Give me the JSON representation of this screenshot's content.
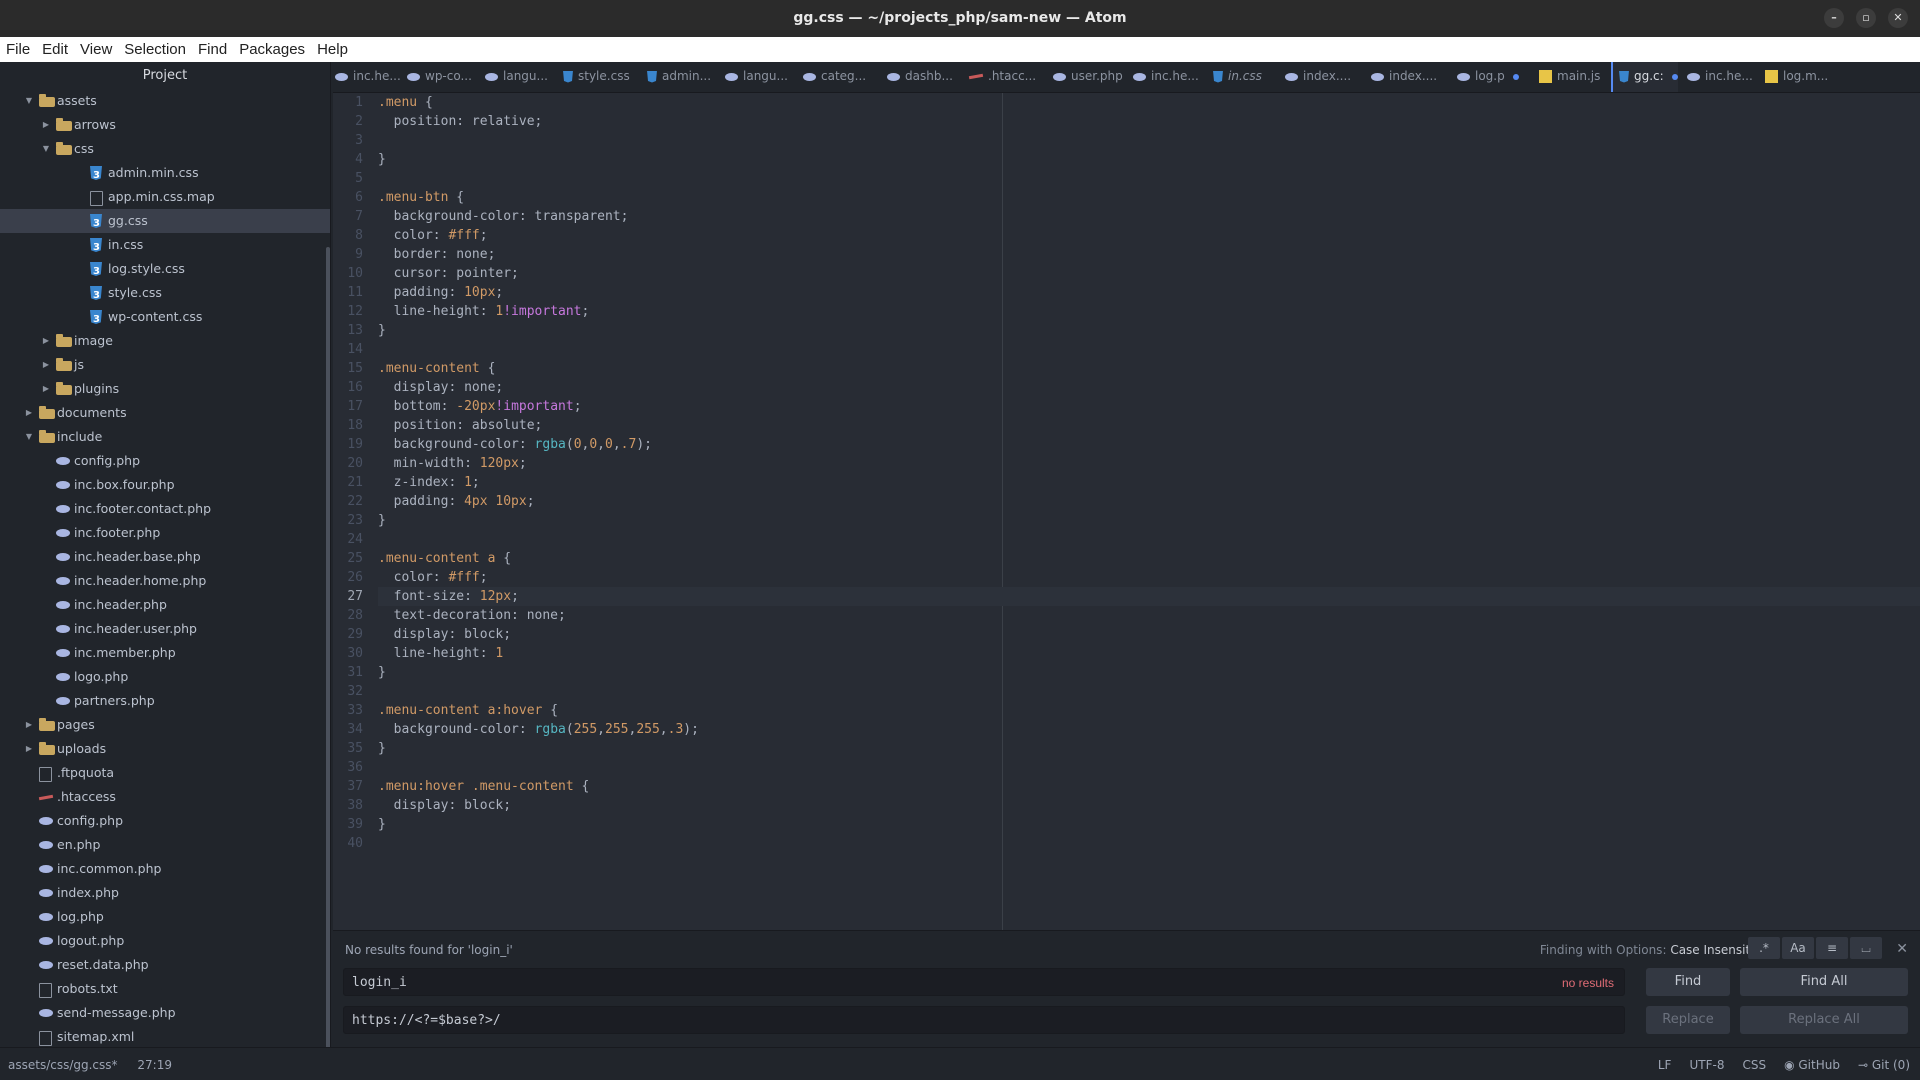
{
  "window": {
    "title": "gg.css — ~/projects_php/sam-new — Atom"
  },
  "menu": [
    "File",
    "Edit",
    "View",
    "Selection",
    "Find",
    "Packages",
    "Help"
  ],
  "sidebar": {
    "title": "Project",
    "tree": [
      {
        "label": "assets",
        "type": "folder",
        "depth": 0,
        "expanded": true
      },
      {
        "label": "arrows",
        "type": "folder",
        "depth": 1,
        "expanded": false
      },
      {
        "label": "css",
        "type": "folder",
        "depth": 1,
        "expanded": true
      },
      {
        "label": "admin.min.css",
        "type": "css3",
        "depth": 2
      },
      {
        "label": "app.min.css.map",
        "type": "file",
        "depth": 2
      },
      {
        "label": "gg.css",
        "type": "css3",
        "depth": 2,
        "selected": true
      },
      {
        "label": "in.css",
        "type": "css3",
        "depth": 2
      },
      {
        "label": "log.style.css",
        "type": "css3",
        "depth": 2
      },
      {
        "label": "style.css",
        "type": "css3",
        "depth": 2
      },
      {
        "label": "wp-content.css",
        "type": "css3",
        "depth": 2
      },
      {
        "label": "image",
        "type": "folder",
        "depth": 1,
        "expanded": false
      },
      {
        "label": "js",
        "type": "folder",
        "depth": 1,
        "expanded": false
      },
      {
        "label": "plugins",
        "type": "folder",
        "depth": 1,
        "expanded": false
      },
      {
        "label": "documents",
        "type": "folder",
        "depth": 0,
        "expanded": false
      },
      {
        "label": "include",
        "type": "folder",
        "depth": 0,
        "expanded": true
      },
      {
        "label": "config.php",
        "type": "php",
        "depth": 1
      },
      {
        "label": "inc.box.four.php",
        "type": "php",
        "depth": 1
      },
      {
        "label": "inc.footer.contact.php",
        "type": "php",
        "depth": 1
      },
      {
        "label": "inc.footer.php",
        "type": "php",
        "depth": 1
      },
      {
        "label": "inc.header.base.php",
        "type": "php",
        "depth": 1
      },
      {
        "label": "inc.header.home.php",
        "type": "php",
        "depth": 1
      },
      {
        "label": "inc.header.php",
        "type": "php",
        "depth": 1
      },
      {
        "label": "inc.header.user.php",
        "type": "php",
        "depth": 1
      },
      {
        "label": "inc.member.php",
        "type": "php",
        "depth": 1
      },
      {
        "label": "logo.php",
        "type": "php",
        "depth": 1
      },
      {
        "label": "partners.php",
        "type": "php",
        "depth": 1
      },
      {
        "label": "pages",
        "type": "folder",
        "depth": 0,
        "expanded": false
      },
      {
        "label": "uploads",
        "type": "folder",
        "depth": 0,
        "expanded": false
      },
      {
        "label": ".ftpquota",
        "type": "file",
        "depth": 0
      },
      {
        "label": ".htaccess",
        "type": "htaccess",
        "depth": 0
      },
      {
        "label": "config.php",
        "type": "php",
        "depth": 0
      },
      {
        "label": "en.php",
        "type": "php",
        "depth": 0
      },
      {
        "label": "inc.common.php",
        "type": "php",
        "depth": 0
      },
      {
        "label": "index.php",
        "type": "php",
        "depth": 0
      },
      {
        "label": "log.php",
        "type": "php",
        "depth": 0
      },
      {
        "label": "logout.php",
        "type": "php",
        "depth": 0
      },
      {
        "label": "reset.data.php",
        "type": "php",
        "depth": 0
      },
      {
        "label": "robots.txt",
        "type": "file",
        "depth": 0
      },
      {
        "label": "send-message.php",
        "type": "php",
        "depth": 0
      },
      {
        "label": "sitemap.xml",
        "type": "file",
        "depth": 0
      }
    ]
  },
  "tabs": [
    {
      "label": "inc.he...",
      "icon": "php"
    },
    {
      "label": "wp-co...",
      "icon": "php"
    },
    {
      "label": "langu...",
      "icon": "php"
    },
    {
      "label": "style.css",
      "icon": "css"
    },
    {
      "label": "admin...",
      "icon": "css"
    },
    {
      "label": "langu...",
      "icon": "php"
    },
    {
      "label": "categ...",
      "icon": "php"
    },
    {
      "label": "dashb...",
      "icon": "php"
    },
    {
      "label": ".htacc...",
      "icon": "ht"
    },
    {
      "label": "user.php",
      "icon": "php"
    },
    {
      "label": "inc.he...",
      "icon": "php"
    },
    {
      "label": "in.css",
      "icon": "css",
      "italic": true
    },
    {
      "label": "index....",
      "icon": "php"
    },
    {
      "label": "index....",
      "icon": "php"
    },
    {
      "label": "log.p",
      "icon": "php",
      "modified": true
    },
    {
      "label": "main.js",
      "icon": "js"
    },
    {
      "label": "gg.c:",
      "icon": "css",
      "modified": true,
      "active": true
    },
    {
      "label": "inc.he...",
      "icon": "php"
    },
    {
      "label": "log.m...",
      "icon": "js"
    }
  ],
  "editor": {
    "cursor_line": 27,
    "lines": [
      [
        [
          "sel-c",
          ".menu"
        ],
        [
          "pl",
          " {"
        ]
      ],
      [
        [
          "prop",
          "  position: relative;"
        ]
      ],
      [],
      [
        [
          "pl",
          "}"
        ]
      ],
      [],
      [
        [
          "sel-c",
          ".menu-btn"
        ],
        [
          "pl",
          " {"
        ]
      ],
      [
        [
          "prop",
          "  background-color: transparent;"
        ]
      ],
      [
        [
          "prop",
          "  color: "
        ],
        [
          "num",
          "#fff"
        ],
        [
          "pl",
          ";"
        ]
      ],
      [
        [
          "prop",
          "  border: none;"
        ]
      ],
      [
        [
          "prop",
          "  cursor: pointer;"
        ]
      ],
      [
        [
          "prop",
          "  padding: "
        ],
        [
          "num",
          "10px"
        ],
        [
          "pl",
          ";"
        ]
      ],
      [
        [
          "prop",
          "  line-height: "
        ],
        [
          "num",
          "1"
        ],
        [
          "kw",
          "!important"
        ],
        [
          "pl",
          ";"
        ]
      ],
      [
        [
          "pl",
          "}"
        ]
      ],
      [],
      [
        [
          "sel-c",
          ".menu-content"
        ],
        [
          "pl",
          " {"
        ]
      ],
      [
        [
          "prop",
          "  display: none;"
        ]
      ],
      [
        [
          "prop",
          "  bottom: "
        ],
        [
          "num",
          "-20px"
        ],
        [
          "kw",
          "!important"
        ],
        [
          "pl",
          ";"
        ]
      ],
      [
        [
          "prop",
          "  position: absolute;"
        ]
      ],
      [
        [
          "prop",
          "  background-color: "
        ],
        [
          "fn",
          "rgba"
        ],
        [
          "pl",
          "("
        ],
        [
          "num",
          "0"
        ],
        [
          "pl",
          ","
        ],
        [
          "num",
          "0"
        ],
        [
          "pl",
          ","
        ],
        [
          "num",
          "0"
        ],
        [
          "pl",
          ","
        ],
        [
          "num",
          ".7"
        ],
        [
          "pl",
          ");"
        ]
      ],
      [
        [
          "prop",
          "  min-width: "
        ],
        [
          "num",
          "120px"
        ],
        [
          "pl",
          ";"
        ]
      ],
      [
        [
          "prop",
          "  z-index: "
        ],
        [
          "num",
          "1"
        ],
        [
          "pl",
          ";"
        ]
      ],
      [
        [
          "prop",
          "  padding: "
        ],
        [
          "num",
          "4px 10px"
        ],
        [
          "pl",
          ";"
        ]
      ],
      [
        [
          "pl",
          "}"
        ]
      ],
      [],
      [
        [
          "sel-c",
          ".menu-content a"
        ],
        [
          "pl",
          " {"
        ]
      ],
      [
        [
          "prop",
          "  color: "
        ],
        [
          "num",
          "#fff"
        ],
        [
          "pl",
          ";"
        ]
      ],
      [
        [
          "prop",
          "  font-size: "
        ],
        [
          "num",
          "12px"
        ],
        [
          "pl",
          ";"
        ]
      ],
      [
        [
          "prop",
          "  text-decoration: none;"
        ]
      ],
      [
        [
          "prop",
          "  display: block;"
        ]
      ],
      [
        [
          "prop",
          "  line-height: "
        ],
        [
          "num",
          "1"
        ]
      ],
      [
        [
          "pl",
          "}"
        ]
      ],
      [],
      [
        [
          "sel-c",
          ".menu-content a:hover"
        ],
        [
          "pl",
          " {"
        ]
      ],
      [
        [
          "prop",
          "  background-color: "
        ],
        [
          "fn",
          "rgba"
        ],
        [
          "pl",
          "("
        ],
        [
          "num",
          "255"
        ],
        [
          "pl",
          ","
        ],
        [
          "num",
          "255"
        ],
        [
          "pl",
          ","
        ],
        [
          "num",
          "255"
        ],
        [
          "pl",
          ","
        ],
        [
          "num",
          ".3"
        ],
        [
          "pl",
          ");"
        ]
      ],
      [
        [
          "pl",
          "}"
        ]
      ],
      [],
      [
        [
          "sel-c",
          ".menu:hover .menu-content"
        ],
        [
          "pl",
          " {"
        ]
      ],
      [
        [
          "prop",
          "  display: block;"
        ]
      ],
      [
        [
          "pl",
          "}"
        ]
      ],
      []
    ]
  },
  "find": {
    "description": "No results found for 'login_i'",
    "options_prefix": "Finding with Options:",
    "options_value": "Case Insensitive",
    "option_buttons": [
      ".*",
      "Aa",
      "≡",
      "⌴"
    ],
    "find_value": "login_i",
    "no_results": "no results",
    "replace_value": "https://<?=$base?>/",
    "find_label": "Find",
    "find_all_label": "Find All",
    "replace_label": "Replace",
    "replace_all_label": "Replace All"
  },
  "status": {
    "path": "assets/css/gg.css*",
    "position": "27:19",
    "line_ending": "LF",
    "encoding": "UTF-8",
    "grammar": "CSS",
    "github": "GitHub",
    "git": "Git (0)"
  }
}
